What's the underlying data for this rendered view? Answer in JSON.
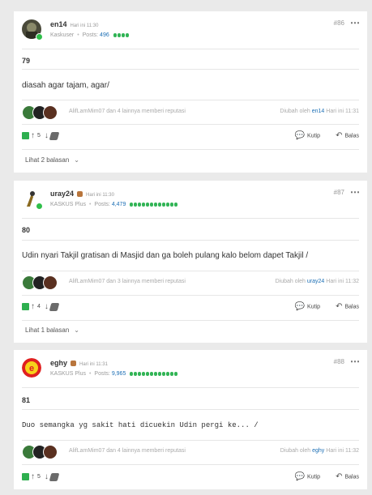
{
  "posts": [
    {
      "username": "en14",
      "time": "Hari ini 11:30",
      "rank": "Kaskuser",
      "posts_label": "Posts:",
      "posts_count": "496",
      "post_no": "#86",
      "score": "79",
      "text": "diasah agar tajam, agar/",
      "reputation": "AlifLamMim07 dan 4 lainnya memberi reputasi",
      "edited_prefix": "Diubah oleh",
      "edited_by": "en14",
      "edited_time": "Hari ini 11:31",
      "count": "5",
      "quote_label": "Kutip",
      "reply_label": "Balas",
      "replies_label": "Lihat 2 balasan"
    },
    {
      "username": "uray24",
      "time": "Hari ini 11:30",
      "rank": "KASKUS Plus",
      "posts_label": "Posts:",
      "posts_count": "4,479",
      "post_no": "#87",
      "score": "80",
      "text": "Udin nyari Takjil gratisan di Masjid dan ga boleh pulang kalo belom dapet Takjil /",
      "reputation": "AlifLamMim07 dan 3 lainnya memberi reputasi",
      "edited_prefix": "Diubah oleh",
      "edited_by": "uray24",
      "edited_time": "Hari ini 11:32",
      "count": "4",
      "quote_label": "Kutip",
      "reply_label": "Balas",
      "replies_label": "Lihat 1 balasan"
    },
    {
      "username": "eghy",
      "time": "Hari ini 11:31",
      "rank": "KASKUS Plus",
      "posts_label": "Posts:",
      "posts_count": "9,965",
      "post_no": "#88",
      "score": "81",
      "text": "Duo semangka yg sakit hati dicuekin Udin pergi ke... /",
      "reputation": "AlifLamMim07 dan 4 lainnya memberi reputasi",
      "edited_prefix": "Diubah oleh",
      "edited_by": "eghy",
      "edited_time": "Hari ini 11:32",
      "count": "5",
      "quote_label": "Kutip",
      "reply_label": "Balas"
    }
  ],
  "colors": {
    "accent": "#1c6fb5",
    "online": "#2fbf4a",
    "reputation_dots": "#31b455"
  },
  "icons": {
    "more": "⋯",
    "up": "↑",
    "down": "↓",
    "quote": "quote-icon",
    "reply": "↶",
    "chevron": "⌄"
  }
}
